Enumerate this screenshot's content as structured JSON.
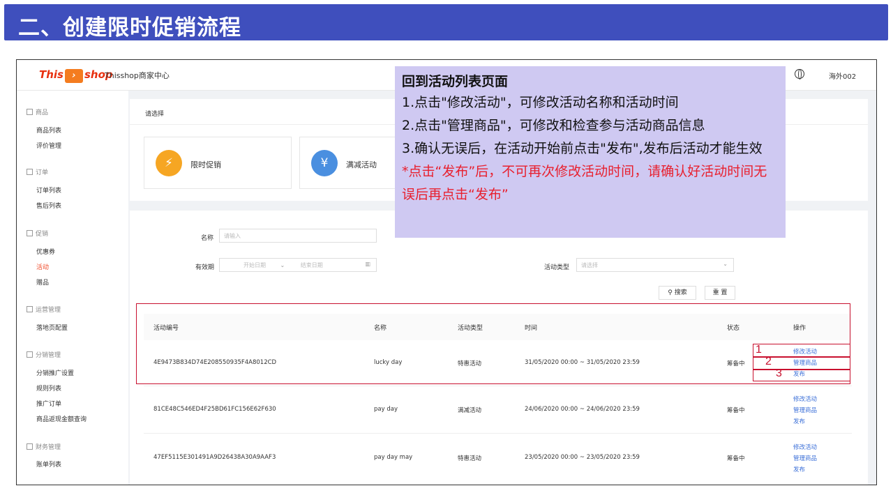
{
  "slide": {
    "title": "二、创建限时促销流程"
  },
  "topbar": {
    "logo_part1": "This",
    "logo_part2": "shop",
    "app_name": "Thisshop商家中心",
    "language_icon": "globe-icon",
    "user_name": "海外002"
  },
  "sidebar": {
    "groups": [
      {
        "label": "商品",
        "items": [
          "商品列表",
          "评价管理"
        ]
      },
      {
        "label": "订单",
        "items": [
          "订单列表",
          "售后列表"
        ]
      },
      {
        "label": "促销",
        "items": [
          "优惠券",
          "活动",
          "赠品"
        ]
      },
      {
        "label": "运营管理",
        "items": [
          "落地页配置"
        ]
      },
      {
        "label": "分销管理",
        "items": [
          "分销推广设置",
          "规则列表",
          "推广订单",
          "商品返现金额查询"
        ]
      },
      {
        "label": "财务管理",
        "items": [
          "账单列表"
        ]
      }
    ],
    "active_item": "活动",
    "active_color": "#f04b2a"
  },
  "selector": {
    "label": "请选择",
    "cards": [
      {
        "label": "限时促销",
        "icon": "lightning-icon",
        "color": "#f6a623"
      },
      {
        "label": "满减活动",
        "icon": "coupon-icon",
        "color": "#4a8fe0"
      }
    ]
  },
  "filters": {
    "name_label": "名称",
    "name_placeholder": "请输入",
    "period_label": "有效期",
    "start_placeholder": "开始日期",
    "end_placeholder": "结束日期",
    "type_label": "活动类型",
    "type_placeholder": "请选择",
    "search_button": "搜索",
    "reset_button": "重 置"
  },
  "table": {
    "headers": [
      "活动编号",
      "名称",
      "活动类型",
      "时间",
      "状态",
      "操作"
    ],
    "rows": [
      {
        "id": "4E9473B834D74E208550935F4A8012CD",
        "name": "lucky day",
        "type": "特惠活动",
        "time": "31/05/2020 00:00 ~ 31/05/2020 23:59",
        "status": "筹备中",
        "actions": [
          "修改活动",
          "管理商品",
          "发布"
        ]
      },
      {
        "id": "81CE48C546ED4F25BD61FC156E62F630",
        "name": "pay day",
        "type": "满减活动",
        "time": "24/06/2020 00:00 ~ 24/06/2020 23:59",
        "status": "筹备中",
        "actions": [
          "修改活动",
          "管理商品",
          "发布"
        ]
      },
      {
        "id": "47EF5115E301491A9D26438A30A9AAF3",
        "name": "pay day may",
        "type": "特惠活动",
        "time": "23/05/2020 00:00 ~ 23/05/2020 23:59",
        "status": "筹备中",
        "actions": [
          "修改活动",
          "管理商品",
          "发布"
        ]
      }
    ],
    "link_color": "#3b6fd8"
  },
  "annotations": {
    "numbers": [
      "1",
      "2",
      "3"
    ],
    "color": "#c8102e"
  },
  "callout": {
    "heading": "回到活动列表页面",
    "lines": [
      "1.点击\"修改活动\"，可修改活动名称和活动时间",
      "2.点击\"管理商品\"，可修改和检查参与活动商品信息",
      "3.确认无误后，在活动开始前点击\"发布\",发布后活动才能生效"
    ],
    "warning": "*点击“发布”后，不可再次修改活动时间，请确认好活动时间无误后再点击“发布”",
    "background": "#cfc9f2",
    "warning_color": "#e8202e"
  }
}
